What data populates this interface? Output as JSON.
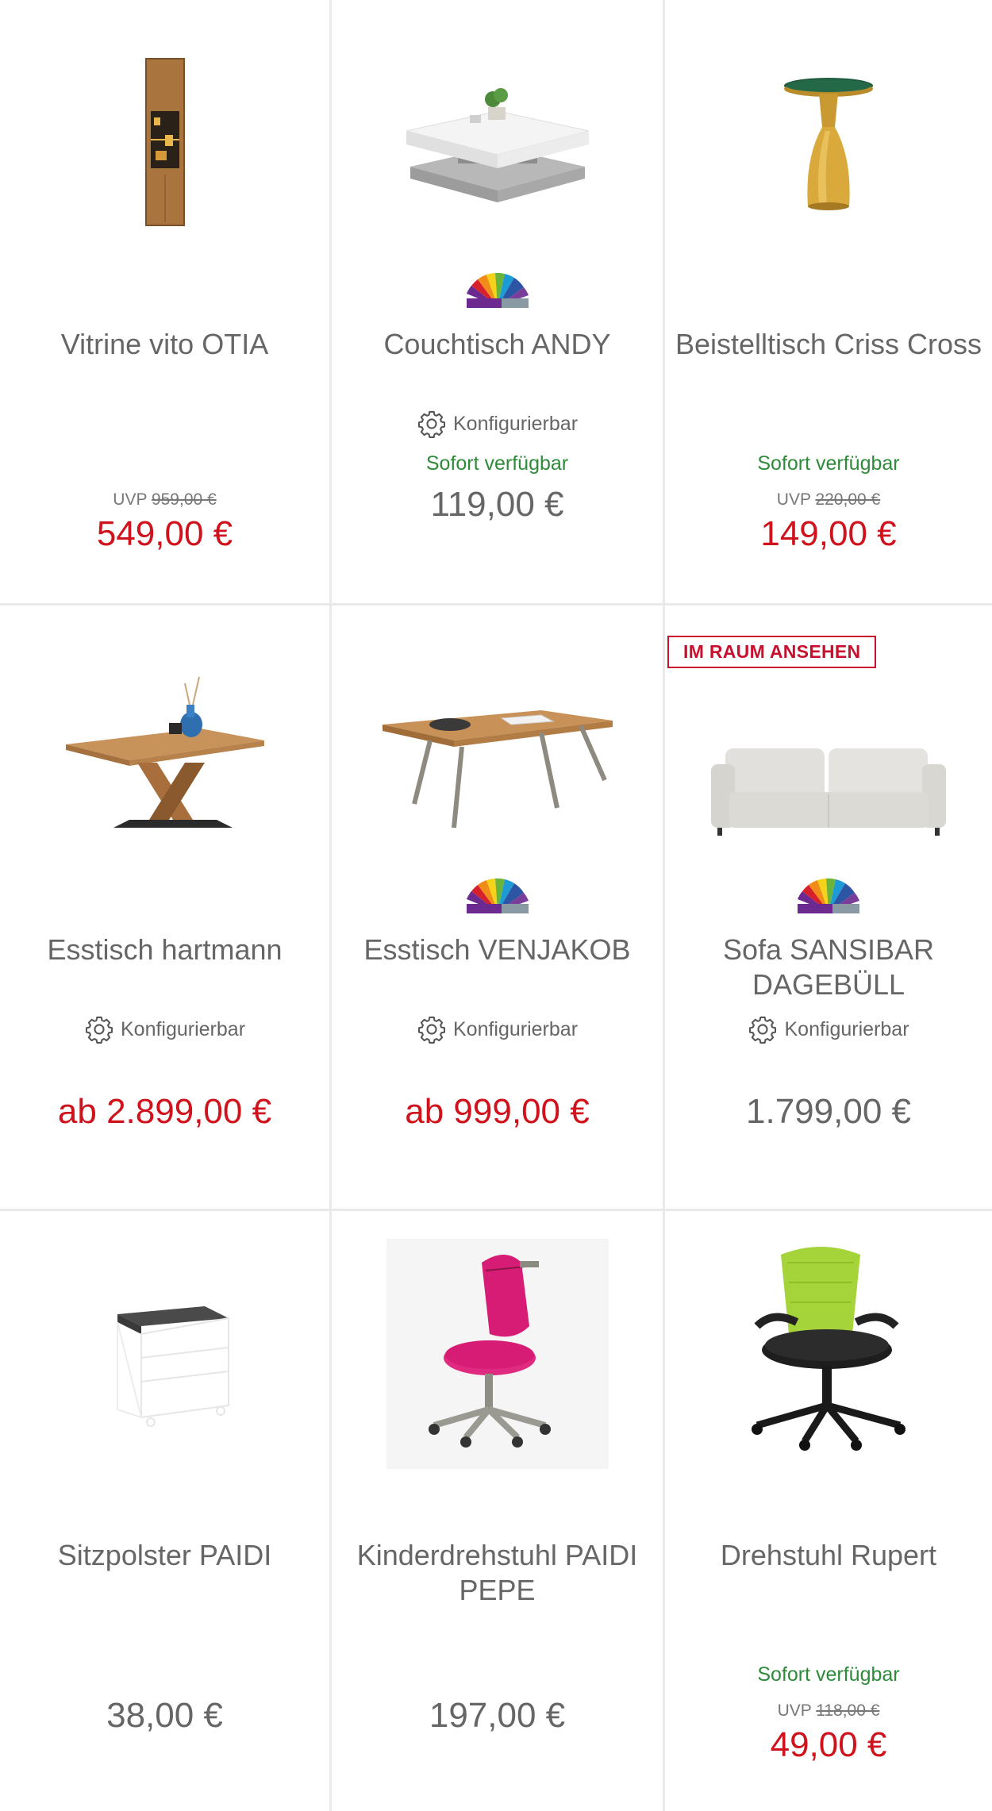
{
  "labels": {
    "configurable": "Konfigurierbar",
    "available": "Sofort verfügbar",
    "uvp_prefix": "UVP",
    "ar_badge": "IM RAUM ANSEHEN"
  },
  "products": [
    {
      "title": "Vitrine vito OTIA",
      "configurable": false,
      "available": false,
      "uvp": "959,00 €",
      "price": "549,00 €",
      "sale": true,
      "color_fan": false,
      "image_icon": "display-cabinet-image"
    },
    {
      "title": "Couchtisch ANDY",
      "configurable": true,
      "available": true,
      "uvp": "",
      "price": "119,00 €",
      "sale": false,
      "color_fan": true,
      "image_icon": "coffee-table-image"
    },
    {
      "title": "Beistelltisch Criss Cross",
      "configurable": false,
      "available": true,
      "uvp": "220,00 €",
      "price": "149,00 €",
      "sale": true,
      "color_fan": false,
      "image_icon": "side-table-image"
    },
    {
      "title": "Esstisch hartmann",
      "configurable": true,
      "available": false,
      "uvp": "",
      "price": "ab 2.899,00 €",
      "sale": true,
      "color_fan": false,
      "image_icon": "dining-table-image"
    },
    {
      "title": "Esstisch VENJAKOB",
      "configurable": true,
      "available": false,
      "uvp": "",
      "price": "ab 999,00 €",
      "sale": true,
      "color_fan": true,
      "image_icon": "dining-table-image"
    },
    {
      "title": "Sofa SANSIBAR DAGEBÜLL",
      "configurable": true,
      "available": false,
      "uvp": "",
      "price": "1.799,00 €",
      "sale": false,
      "color_fan": true,
      "ar_badge": true,
      "image_icon": "sofa-image"
    },
    {
      "title": "Sitzpolster PAIDI",
      "configurable": false,
      "available": false,
      "uvp": "",
      "price": "38,00 €",
      "sale": false,
      "color_fan": false,
      "image_icon": "drawer-container-image"
    },
    {
      "title": "Kinderdrehstuhl PAIDI PEPE",
      "configurable": false,
      "available": false,
      "uvp": "",
      "price": "197,00 €",
      "sale": false,
      "color_fan": false,
      "image_icon": "kids-chair-image"
    },
    {
      "title": "Drehstuhl Rupert",
      "configurable": false,
      "available": true,
      "uvp": "118,00 €",
      "price": "49,00 €",
      "sale": true,
      "color_fan": false,
      "image_icon": "office-chair-image"
    }
  ],
  "colors": {
    "sale_red": "#d0121c",
    "available_green": "#2e8b3a",
    "text_gray": "#666666",
    "divider": "#e9e9e9"
  }
}
